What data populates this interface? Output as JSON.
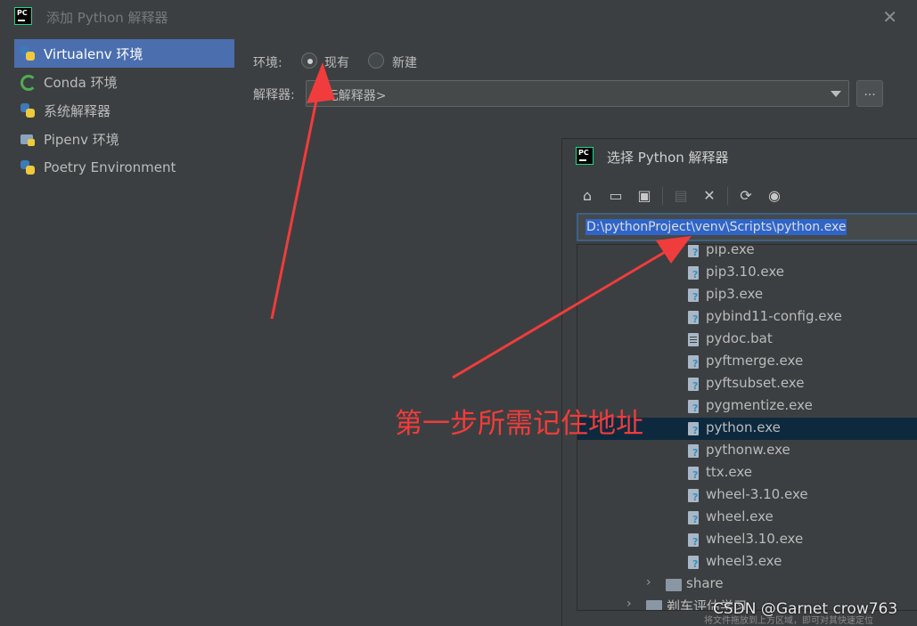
{
  "window": {
    "title": "添加 Python 解释器",
    "close_glyph": "✕"
  },
  "sidebar": {
    "items": [
      {
        "label": "Virtualenv 环境",
        "icon": "python-icon",
        "active": true
      },
      {
        "label": "Conda 环境",
        "icon": "conda-icon",
        "active": false
      },
      {
        "label": "系统解释器",
        "icon": "python-icon",
        "active": false
      },
      {
        "label": "Pipenv 环境",
        "icon": "pipenv-icon",
        "active": false
      },
      {
        "label": "Poetry Environment",
        "icon": "python-icon",
        "active": false
      }
    ]
  },
  "form": {
    "env_label": "环境:",
    "radio_existing": "现有",
    "radio_new": "新建",
    "selected_radio": "现有",
    "interpreter_label": "解释器:",
    "interpreter_value": "<无解释器>",
    "browse_label": "..."
  },
  "chooser": {
    "title": "选择 Python 解释器",
    "toolbar": {
      "home": "⌂",
      "desktop": "▭",
      "project": "▣",
      "new_folder": "▤",
      "delete": "✕",
      "refresh": "⟳",
      "show_hidden": "◉"
    },
    "path": "D:\\pythonProject\\venv\\Scripts\\python.exe",
    "files": [
      {
        "name": "pip.exe",
        "type": "unknown"
      },
      {
        "name": "pip3.10.exe",
        "type": "unknown"
      },
      {
        "name": "pip3.exe",
        "type": "unknown"
      },
      {
        "name": "pybind11-config.exe",
        "type": "unknown"
      },
      {
        "name": "pydoc.bat",
        "type": "bat"
      },
      {
        "name": "pyftmerge.exe",
        "type": "unknown"
      },
      {
        "name": "pyftsubset.exe",
        "type": "unknown"
      },
      {
        "name": "pygmentize.exe",
        "type": "unknown"
      },
      {
        "name": "python.exe",
        "type": "unknown",
        "selected": true
      },
      {
        "name": "pythonw.exe",
        "type": "unknown"
      },
      {
        "name": "ttx.exe",
        "type": "unknown"
      },
      {
        "name": "wheel-3.10.exe",
        "type": "unknown"
      },
      {
        "name": "wheel.exe",
        "type": "unknown"
      },
      {
        "name": "wheel3.10.exe",
        "type": "unknown"
      },
      {
        "name": "wheel3.exe",
        "type": "unknown"
      }
    ],
    "folders": [
      {
        "name": "share",
        "chevron": "›"
      },
      {
        "name": "剃车评估学习",
        "chevron": "›"
      }
    ]
  },
  "annotation": {
    "text": "第一步所需记住地址",
    "color": "#f03c3c"
  },
  "watermark": {
    "text": "CSDN @Garnet crow763",
    "hint": "将文件拖放到上方区域，即可对其快速定位"
  },
  "colors": {
    "background": "#3c3f41",
    "accent": "#4b6eaf",
    "selection": "#0d293e",
    "path_highlight": "#2f65ca"
  }
}
